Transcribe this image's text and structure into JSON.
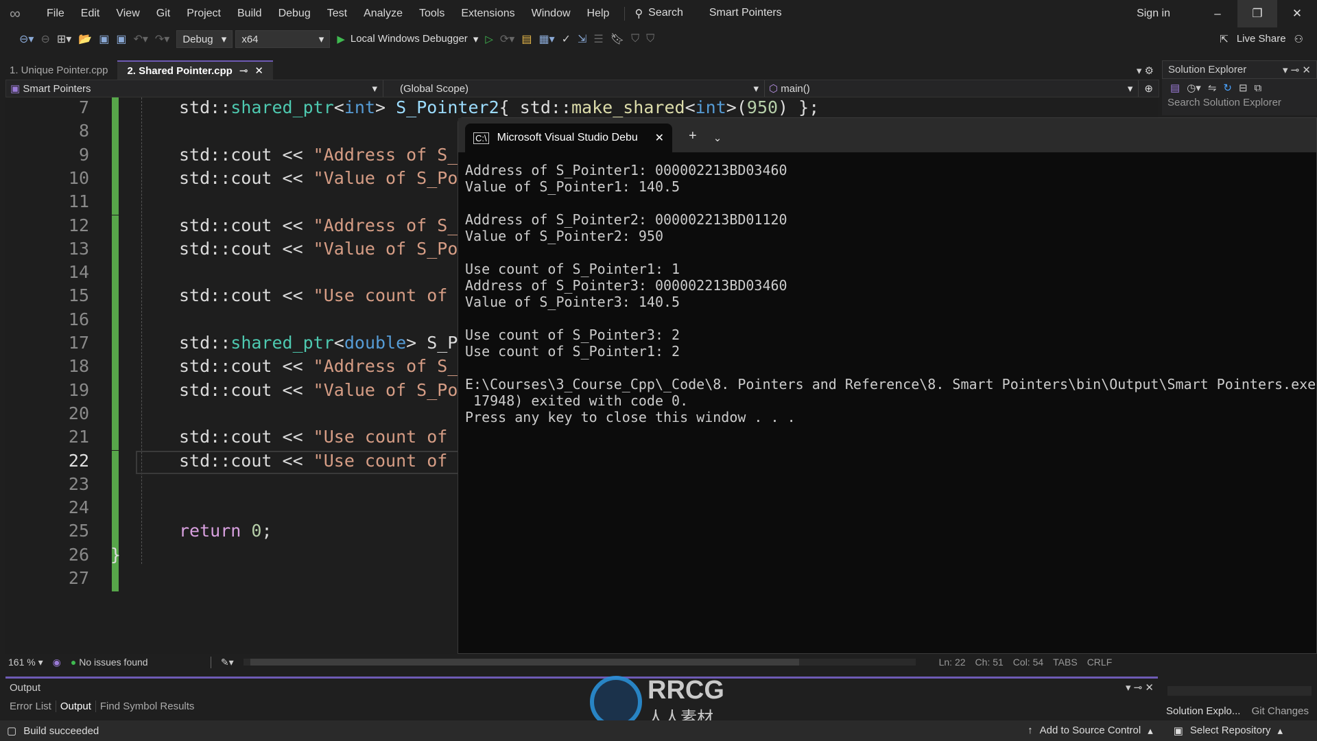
{
  "menubar": {
    "items": [
      "File",
      "Edit",
      "View",
      "Git",
      "Project",
      "Build",
      "Debug",
      "Test",
      "Analyze",
      "Tools",
      "Extensions",
      "Window",
      "Help"
    ],
    "search_label": "Search",
    "solution_title": "Smart Pointers",
    "sign_in": "Sign in"
  },
  "toolbar": {
    "config": "Debug",
    "platform": "x64",
    "debugger": "Local Windows Debugger",
    "live_share": "Live Share"
  },
  "tabs": [
    {
      "label": "1. Unique Pointer.cpp",
      "active": false
    },
    {
      "label": "2. Shared Pointer.cpp",
      "active": true
    }
  ],
  "navbar": {
    "project": "Smart Pointers",
    "scope": "(Global Scope)",
    "member": "main()"
  },
  "solution_explorer": {
    "title": "Solution Explorer",
    "search_placeholder": "Search Solution Explorer"
  },
  "editor": {
    "current_line": 22,
    "lines": [
      {
        "n": "7",
        "tokens": [
          [
            "std::",
            ""
          ],
          [
            "shared_ptr",
            "type"
          ],
          [
            "<",
            ""
          ],
          [
            "int",
            "kw"
          ],
          [
            "> ",
            ""
          ],
          [
            "S_Pointer2",
            "id"
          ],
          [
            "{ std::",
            ""
          ],
          [
            "make_shared",
            "fn"
          ],
          [
            "<",
            ""
          ],
          [
            "int",
            "kw"
          ],
          [
            ">(",
            ""
          ],
          [
            "950",
            "num"
          ],
          [
            ") };",
            ""
          ]
        ]
      },
      {
        "n": "8",
        "tokens": []
      },
      {
        "n": "9",
        "tokens": [
          [
            "std::cout << ",
            ""
          ],
          [
            "\"Address of S_",
            "str"
          ]
        ]
      },
      {
        "n": "10",
        "tokens": [
          [
            "std::cout << ",
            ""
          ],
          [
            "\"Value of S_Po",
            "str"
          ]
        ]
      },
      {
        "n": "11",
        "tokens": []
      },
      {
        "n": "12",
        "tokens": [
          [
            "std::cout << ",
            ""
          ],
          [
            "\"Address of S_",
            "str"
          ]
        ]
      },
      {
        "n": "13",
        "tokens": [
          [
            "std::cout << ",
            ""
          ],
          [
            "\"Value of S_Po",
            "str"
          ]
        ]
      },
      {
        "n": "14",
        "tokens": []
      },
      {
        "n": "15",
        "tokens": [
          [
            "std::cout << ",
            ""
          ],
          [
            "\"Use count of",
            "str"
          ]
        ]
      },
      {
        "n": "16",
        "tokens": []
      },
      {
        "n": "17",
        "tokens": [
          [
            "std::",
            ""
          ],
          [
            "shared_ptr",
            "type"
          ],
          [
            "<",
            ""
          ],
          [
            "double",
            "kw"
          ],
          [
            "> S_P",
            ""
          ]
        ]
      },
      {
        "n": "18",
        "tokens": [
          [
            "std::cout << ",
            ""
          ],
          [
            "\"Address of S_",
            "str"
          ]
        ]
      },
      {
        "n": "19",
        "tokens": [
          [
            "std::cout << ",
            ""
          ],
          [
            "\"Value of S_Po",
            "str"
          ]
        ]
      },
      {
        "n": "20",
        "tokens": []
      },
      {
        "n": "21",
        "tokens": [
          [
            "std::cout << ",
            ""
          ],
          [
            "\"Use count of",
            "str"
          ]
        ]
      },
      {
        "n": "22",
        "tokens": [
          [
            "std::cout << ",
            ""
          ],
          [
            "\"Use count of",
            "str"
          ]
        ]
      },
      {
        "n": "23",
        "tokens": []
      },
      {
        "n": "24",
        "tokens": []
      },
      {
        "n": "25",
        "tokens": [
          [
            "return",
            "ret"
          ],
          [
            " ",
            ""
          ],
          [
            "0",
            "num"
          ],
          [
            ";",
            ""
          ]
        ]
      },
      {
        "n": "26",
        "tokens": [
          [
            "}",
            ""
          ]
        ]
      },
      {
        "n": "27",
        "tokens": []
      }
    ]
  },
  "console": {
    "tab_title": "Microsoft Visual Studio Debu",
    "lines": [
      "Address of S_Pointer1: 000002213BD03460",
      "Value of S_Pointer1: 140.5",
      "",
      "Address of S_Pointer2: 000002213BD01120",
      "Value of S_Pointer2: 950",
      "",
      "Use count of S_Pointer1: 1",
      "Address of S_Pointer3: 000002213BD03460",
      "Value of S_Pointer3: 140.5",
      "",
      "Use count of S_Pointer3: 2",
      "Use count of S_Pointer1: 2",
      "",
      "E:\\Courses\\3_Course_Cpp\\_Code\\8. Pointers and Reference\\8. Smart Pointers\\bin\\Output\\Smart Pointers.exe",
      " 17948) exited with code 0.",
      "Press any key to close this window . . ."
    ]
  },
  "editor_status": {
    "zoom": "161 %",
    "issues": "No issues found",
    "ln": "Ln: 22",
    "ch": "Ch: 51",
    "col": "Col: 54",
    "tabs": "TABS",
    "eol": "CRLF"
  },
  "output_panel": {
    "title": "Output",
    "tabs": [
      "Error List",
      "Output",
      "Find Symbol Results"
    ],
    "right_tabs": [
      "Solution Explo...",
      "Git Changes"
    ]
  },
  "statusbar": {
    "build": "Build succeeded",
    "source_control": "Add to Source Control",
    "repo": "Select Repository"
  },
  "watermark": {
    "text": "RRCG",
    "subtext": "人人素材"
  },
  "colors": {
    "accent": "#6e5bb5",
    "git_added": "#57a64a",
    "console_bg": "#0c0c0c"
  }
}
